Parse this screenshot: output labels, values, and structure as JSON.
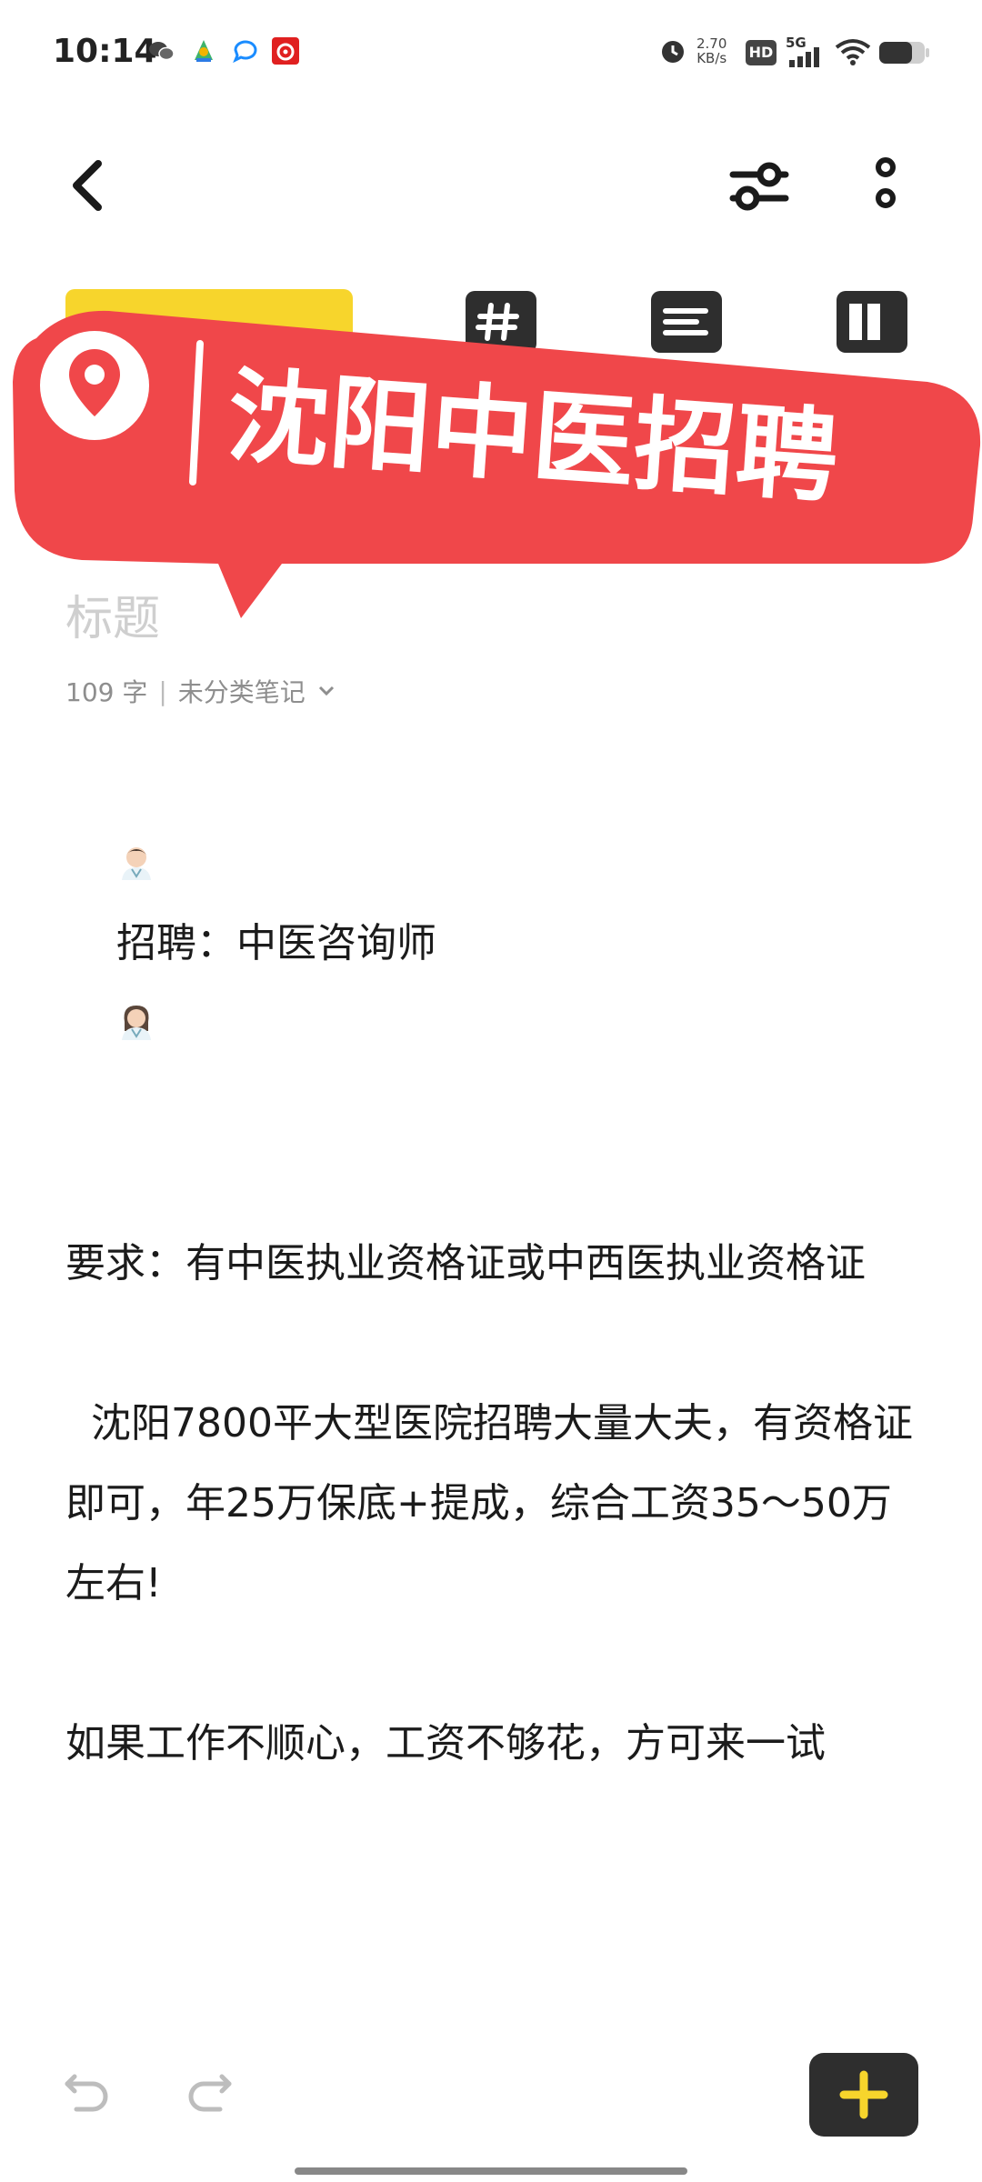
{
  "status_bar": {
    "time": "10:14",
    "net_speed_value": "2.70",
    "net_speed_unit": "KB/s",
    "hd_label": "HD",
    "network": "5G",
    "icons": [
      "wechat-icon",
      "maps-icon",
      "chat-icon",
      "netease-music-icon",
      "alarm-icon",
      "signal-icon",
      "wifi-icon",
      "battery-icon"
    ]
  },
  "toolbar": {
    "icons": [
      "back-icon",
      "tune-icon",
      "more-vertical-icon"
    ],
    "format_icons": [
      "hashtag-icon",
      "list-icon",
      "layout-icon"
    ]
  },
  "banner": {
    "text": "沈阳中医招聘",
    "color": "#f0474a",
    "icon": "location-pin-icon"
  },
  "note": {
    "title_placeholder": "标题",
    "word_count": "109 字",
    "category": "未分类笔记",
    "line1_label": "招聘：中医咨询师",
    "para2": "要求：有中医执业资格证或中西医执业资格证",
    "para3": "  沈阳7800平大型医院招聘大量大夫，有资格证即可，年25万保底+提成，综合工资35～50万左右!",
    "para4": "如果工作不顺心，工资不够花，方可来一试"
  },
  "bottom_bar": {
    "icons": [
      "undo-icon",
      "redo-icon",
      "add-icon"
    ],
    "accent": "#f7d52c"
  }
}
